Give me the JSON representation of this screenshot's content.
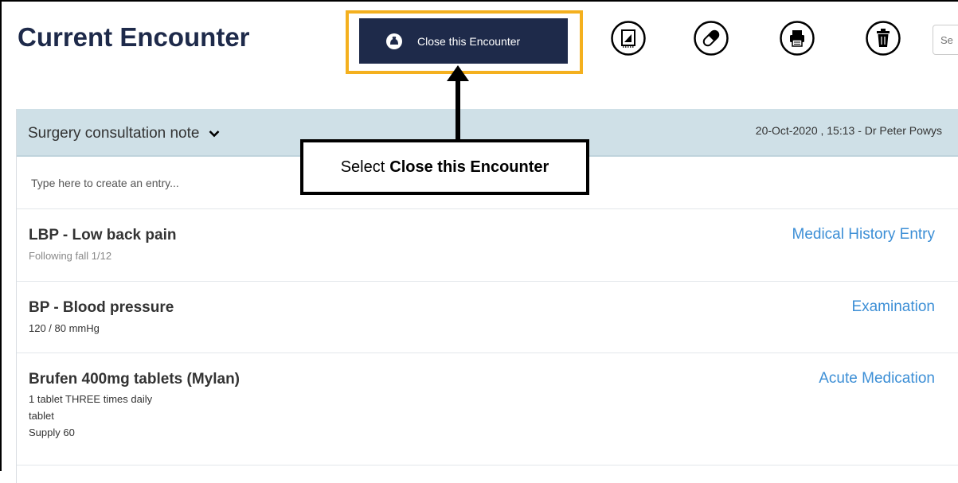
{
  "header": {
    "title": "Current Encounter",
    "close_button_label": "Close this Encounter",
    "search_placeholder": "Se"
  },
  "toolbar": {
    "icons": [
      "draw-pad-icon",
      "pill-icon",
      "printer-icon",
      "trash-icon"
    ]
  },
  "note": {
    "type_label": "Surgery consultation note",
    "meta": "20-Oct-2020 , 15:13 - Dr Peter Powys",
    "entry_placeholder": "Type here to create an entry..."
  },
  "records": [
    {
      "title": "LBP - Low back pain",
      "sub": "Following fall 1/12",
      "type": "Medical History Entry"
    },
    {
      "title": "BP - Blood pressure",
      "detail": "120 / 80 mmHg",
      "type": "Examination"
    },
    {
      "title": "Brufen 400mg tablets (Mylan)",
      "details": [
        "1 tablet THREE times daily",
        "tablet",
        "Supply 60"
      ],
      "type": "Acute Medication"
    }
  ],
  "callout": {
    "prefix": "Select",
    "emphasis": "Close this Encounter"
  },
  "colors": {
    "button_bg": "#1e2a4a",
    "highlight": "#f4b01e",
    "header_bg": "#cfe0e7",
    "link": "#3d8fd6"
  }
}
